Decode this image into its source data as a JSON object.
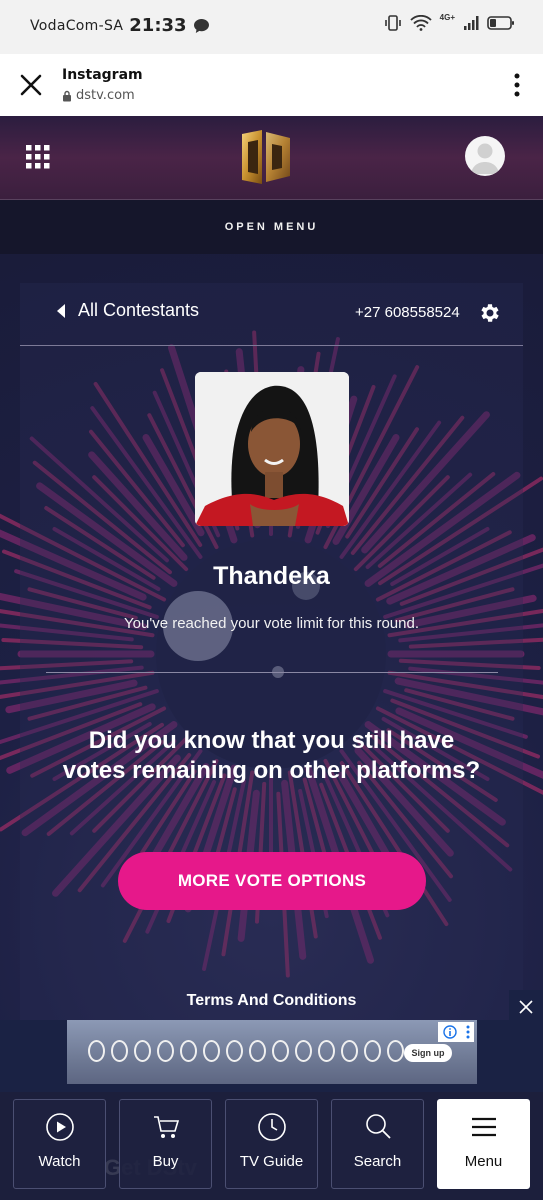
{
  "status_bar": {
    "carrier": "VodaCom-SA",
    "time": "21:33",
    "network": "4G+"
  },
  "browser": {
    "title": "Instagram",
    "url": "dstv.com"
  },
  "header": {
    "open_menu": "OPEN MENU"
  },
  "contestant": {
    "back_label": "All Contestants",
    "phone": "+27 608558524",
    "name": "Thandeka",
    "message": "You've reached your vote limit for this round.",
    "question": "Did you know that you still have votes remaining on other platforms?",
    "cta": "MORE VOTE OPTIONS",
    "terms": "Terms And Conditions"
  },
  "ad": {
    "signup": "Sign up"
  },
  "bottom_nav": {
    "behind_text": "Get DStv",
    "items": [
      {
        "label": "Watch",
        "icon": "play-circle-icon"
      },
      {
        "label": "Buy",
        "icon": "cart-icon"
      },
      {
        "label": "TV Guide",
        "icon": "clock-icon"
      },
      {
        "label": "Search",
        "icon": "search-icon"
      },
      {
        "label": "Menu",
        "icon": "hamburger-icon"
      }
    ]
  },
  "colors": {
    "accent": "#e6188a",
    "background": "#1b1d3a"
  }
}
